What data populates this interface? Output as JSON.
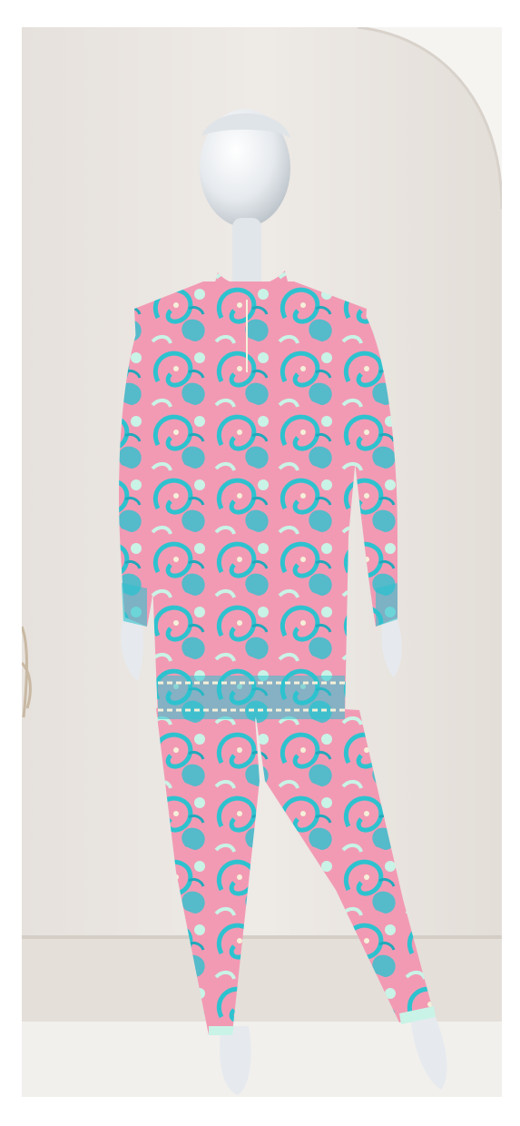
{
  "image": {
    "subject": "mannequin-in-paisley-coord-set",
    "colors": {
      "frame_background": "#ffffff",
      "wall": "#ece8e4",
      "wall_shadow": "#ddd7d1",
      "arch": "#f6f4f1",
      "floor": "#f2f0ed",
      "mannequin": "#e9ecef",
      "fabric_pink": "#f29ab4",
      "fabric_turquoise": "#2ec2cf",
      "fabric_light": "#c9f3e6",
      "fabric_cream": "#f5f0d9"
    }
  }
}
